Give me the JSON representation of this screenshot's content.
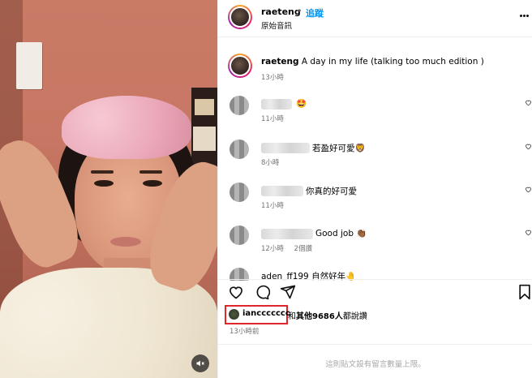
{
  "post": {
    "username": "raeteng",
    "separator": "•",
    "follow_label": "追蹤",
    "audio_label": "原始音訊",
    "caption_text": "A day in my life (talking too much edition )",
    "caption_time": "13小時"
  },
  "comments": [
    {
      "text": "🤩",
      "time": "11小時",
      "replies": ""
    },
    {
      "text": "若盈好可愛🦁",
      "time": "8小時",
      "replies": ""
    },
    {
      "text": "你真的好可愛",
      "time": "11小時",
      "replies": ""
    },
    {
      "text": "Good job 👏🏾",
      "time": "12小時",
      "replies": "2個讚"
    },
    {
      "text": "aden_ff199 自然好年🤚",
      "time": "",
      "replies": ""
    }
  ],
  "likes": {
    "first_liker": "ianccccccc",
    "rest_prefix": "和",
    "others_label": "其他9686人",
    "suffix": "都說讚"
  },
  "post_time": "13小時前",
  "footer_notice": "這則貼文設有留言數量上限。",
  "icons": [
    "more-icon",
    "heart-icon",
    "comment-icon",
    "share-icon",
    "bookmark-icon",
    "mute-icon"
  ],
  "colors": {
    "accent": "#0095f6",
    "highlight_box": "#e0262b",
    "muted_text": "#737373"
  }
}
